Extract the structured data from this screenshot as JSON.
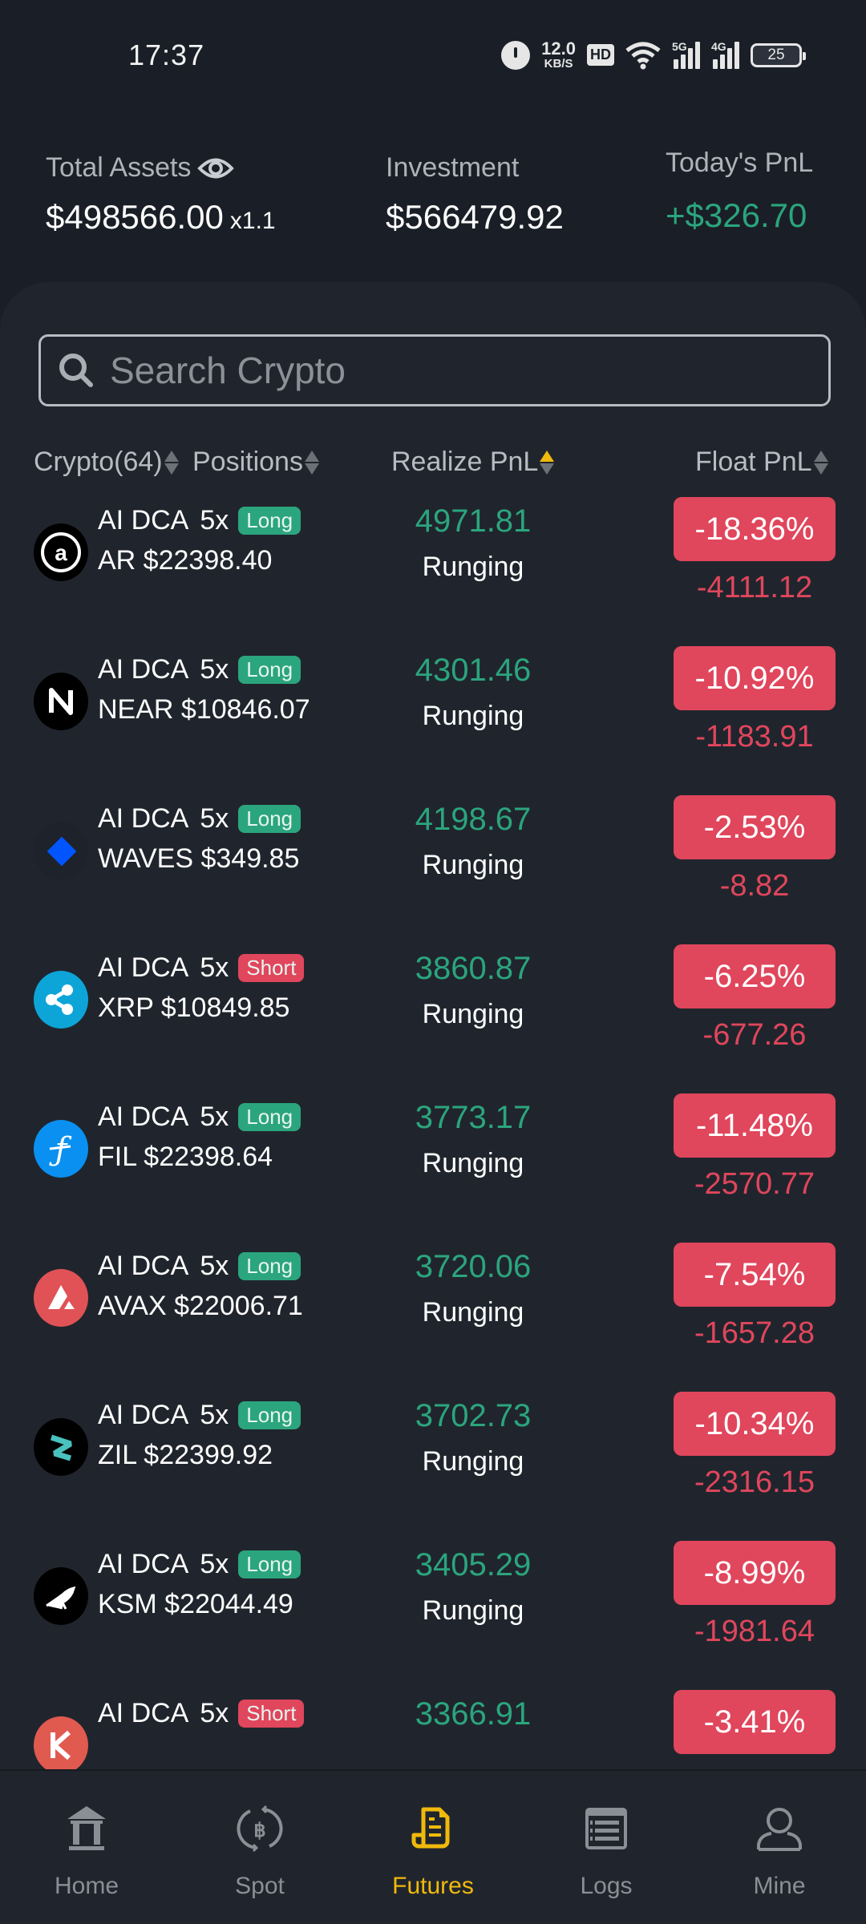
{
  "status_bar": {
    "time": "17:37",
    "net_speed_value": "12.0",
    "net_speed_unit": "KB/S",
    "hd_label": "HD",
    "sim1_label": "5G",
    "sim2_label": "4G",
    "battery": "25"
  },
  "summary": {
    "total_assets_label": "Total Assets",
    "total_assets_value": "$498566.00",
    "multiplier": "x1.1",
    "investment_label": "Investment",
    "investment_value": "$566479.92",
    "todays_pnl_label": "Today's PnL",
    "todays_pnl_value": "+$326.70"
  },
  "search": {
    "placeholder": "Search Crypto",
    "value": ""
  },
  "columns": {
    "crypto": "Crypto(64)",
    "positions": "Positions",
    "realize_pnl": "Realize PnL",
    "float_pnl": "Float PnL",
    "active_sort": "realize_pnl_ascending"
  },
  "colors": {
    "positive": "#2ba57d",
    "negative": "#e0465c",
    "accent": "#f0b90b",
    "background": "#1a1f27",
    "panel": "#20252d"
  },
  "positions": [
    {
      "coin": "AR",
      "icon": "arweave-icon",
      "bot": "AI DCA",
      "leverage": "5x",
      "side": "Long",
      "pair": "AR $22398.40",
      "realize_pnl": "4971.81",
      "state": "Runging",
      "float_pct": "-18.36%",
      "float_amt": "-4111.12"
    },
    {
      "coin": "NEAR",
      "icon": "near-icon",
      "bot": "AI DCA",
      "leverage": "5x",
      "side": "Long",
      "pair": "NEAR $10846.07",
      "realize_pnl": "4301.46",
      "state": "Runging",
      "float_pct": "-10.92%",
      "float_amt": "-1183.91"
    },
    {
      "coin": "WAVES",
      "icon": "waves-icon",
      "bot": "AI DCA",
      "leverage": "5x",
      "side": "Long",
      "pair": "WAVES $349.85",
      "realize_pnl": "4198.67",
      "state": "Runging",
      "float_pct": "-2.53%",
      "float_amt": "-8.82"
    },
    {
      "coin": "XRP",
      "icon": "xrp-icon",
      "bot": "AI DCA",
      "leverage": "5x",
      "side": "Short",
      "pair": "XRP $10849.85",
      "realize_pnl": "3860.87",
      "state": "Runging",
      "float_pct": "-6.25%",
      "float_amt": "-677.26"
    },
    {
      "coin": "FIL",
      "icon": "filecoin-icon",
      "bot": "AI DCA",
      "leverage": "5x",
      "side": "Long",
      "pair": "FIL $22398.64",
      "realize_pnl": "3773.17",
      "state": "Runging",
      "float_pct": "-11.48%",
      "float_amt": "-2570.77"
    },
    {
      "coin": "AVAX",
      "icon": "avalanche-icon",
      "bot": "AI DCA",
      "leverage": "5x",
      "side": "Long",
      "pair": "AVAX $22006.71",
      "realize_pnl": "3720.06",
      "state": "Runging",
      "float_pct": "-7.54%",
      "float_amt": "-1657.28"
    },
    {
      "coin": "ZIL",
      "icon": "zilliqa-icon",
      "bot": "AI DCA",
      "leverage": "5x",
      "side": "Long",
      "pair": "ZIL $22399.92",
      "realize_pnl": "3702.73",
      "state": "Runging",
      "float_pct": "-10.34%",
      "float_amt": "-2316.15"
    },
    {
      "coin": "KSM",
      "icon": "kusama-icon",
      "bot": "AI DCA",
      "leverage": "5x",
      "side": "Long",
      "pair": "KSM $22044.49",
      "realize_pnl": "3405.29",
      "state": "Runging",
      "float_pct": "-8.99%",
      "float_amt": "-1981.64"
    },
    {
      "coin": "",
      "icon": "kava-icon",
      "bot": "AI DCA",
      "leverage": "5x",
      "side": "Short",
      "pair": "",
      "realize_pnl": "3366.91",
      "state": "",
      "float_pct": "-3.41%",
      "float_amt": ""
    }
  ],
  "bottom_nav": [
    {
      "label": "Home",
      "icon": "bank-icon",
      "active": false
    },
    {
      "label": "Spot",
      "icon": "bitcoin-exchange-icon",
      "active": false
    },
    {
      "label": "Futures",
      "icon": "document-icon",
      "active": true
    },
    {
      "label": "Logs",
      "icon": "list-icon",
      "active": false
    },
    {
      "label": "Mine",
      "icon": "user-icon",
      "active": false
    }
  ]
}
